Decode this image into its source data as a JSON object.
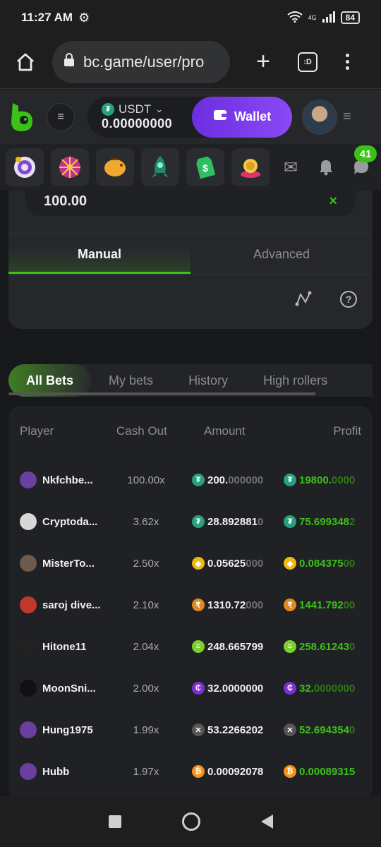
{
  "status": {
    "time": "11:27 AM",
    "network": "4G",
    "battery": "84"
  },
  "browser": {
    "url": "bc.game/user/pro",
    "tabs_label": ":D"
  },
  "header": {
    "currency": "USDT",
    "balance": "0.00000000",
    "wallet_label": "Wallet"
  },
  "games": {
    "notification_count": "41"
  },
  "bet_form": {
    "amount": "100.00",
    "mode_tabs": [
      "Manual",
      "Advanced"
    ]
  },
  "bets": {
    "tabs": [
      "All Bets",
      "My bets",
      "History",
      "High rollers"
    ],
    "columns": [
      "Player",
      "Cash Out",
      "Amount",
      "Profit"
    ],
    "rows": [
      {
        "player": "Nkfchbe...",
        "cashout": "100.00x",
        "amount_main": "200.",
        "amount_dim": "000000",
        "profit_main": "19800.",
        "profit_dim": "0000",
        "coin": "usdt",
        "avatar_color": "#6b3fa0"
      },
      {
        "player": "Cryptoda...",
        "cashout": "3.62x",
        "amount_main": "28.892881",
        "amount_dim": "0",
        "profit_main": "75.699348",
        "profit_dim": "2",
        "coin": "usdt",
        "avatar_color": "#d7d7d7"
      },
      {
        "player": "MisterTo...",
        "cashout": "2.50x",
        "amount_main": "0.05625",
        "amount_dim": "000",
        "profit_main": "0.084375",
        "profit_dim": "00",
        "coin": "bnb",
        "avatar_color": "#6d5a4d"
      },
      {
        "player": "saroj dive...",
        "cashout": "2.10x",
        "amount_main": "1310.72",
        "amount_dim": "000",
        "profit_main": "1441.792",
        "profit_dim": "00",
        "coin": "inr",
        "avatar_color": "#c0392b"
      },
      {
        "player": "Hitone11",
        "cashout": "2.04x",
        "amount_main": "248.665799",
        "amount_dim": "",
        "profit_main": "258.61243",
        "profit_dim": "0",
        "coin": "green",
        "avatar_color": "#222"
      },
      {
        "player": "MoonSni...",
        "cashout": "2.00x",
        "amount_main": "32.0000000",
        "amount_dim": "",
        "profit_main": "32.",
        "profit_dim": "0000000",
        "coin": "purple",
        "avatar_color": "#111"
      },
      {
        "player": "Hung1975",
        "cashout": "1.99x",
        "amount_main": "53.2266202",
        "amount_dim": "",
        "profit_main": "52.694354",
        "profit_dim": "0",
        "coin": "x",
        "avatar_color": "#6b3fa0"
      },
      {
        "player": "Hubb",
        "cashout": "1.97x",
        "amount_main": "0.00092078",
        "amount_dim": "",
        "profit_main": "0.00089315",
        "profit_dim": "",
        "coin": "btc",
        "avatar_color": "#6b3fa0"
      }
    ]
  },
  "colors": {
    "accent": "#3bc117",
    "wallet": "#7a3ff0"
  }
}
